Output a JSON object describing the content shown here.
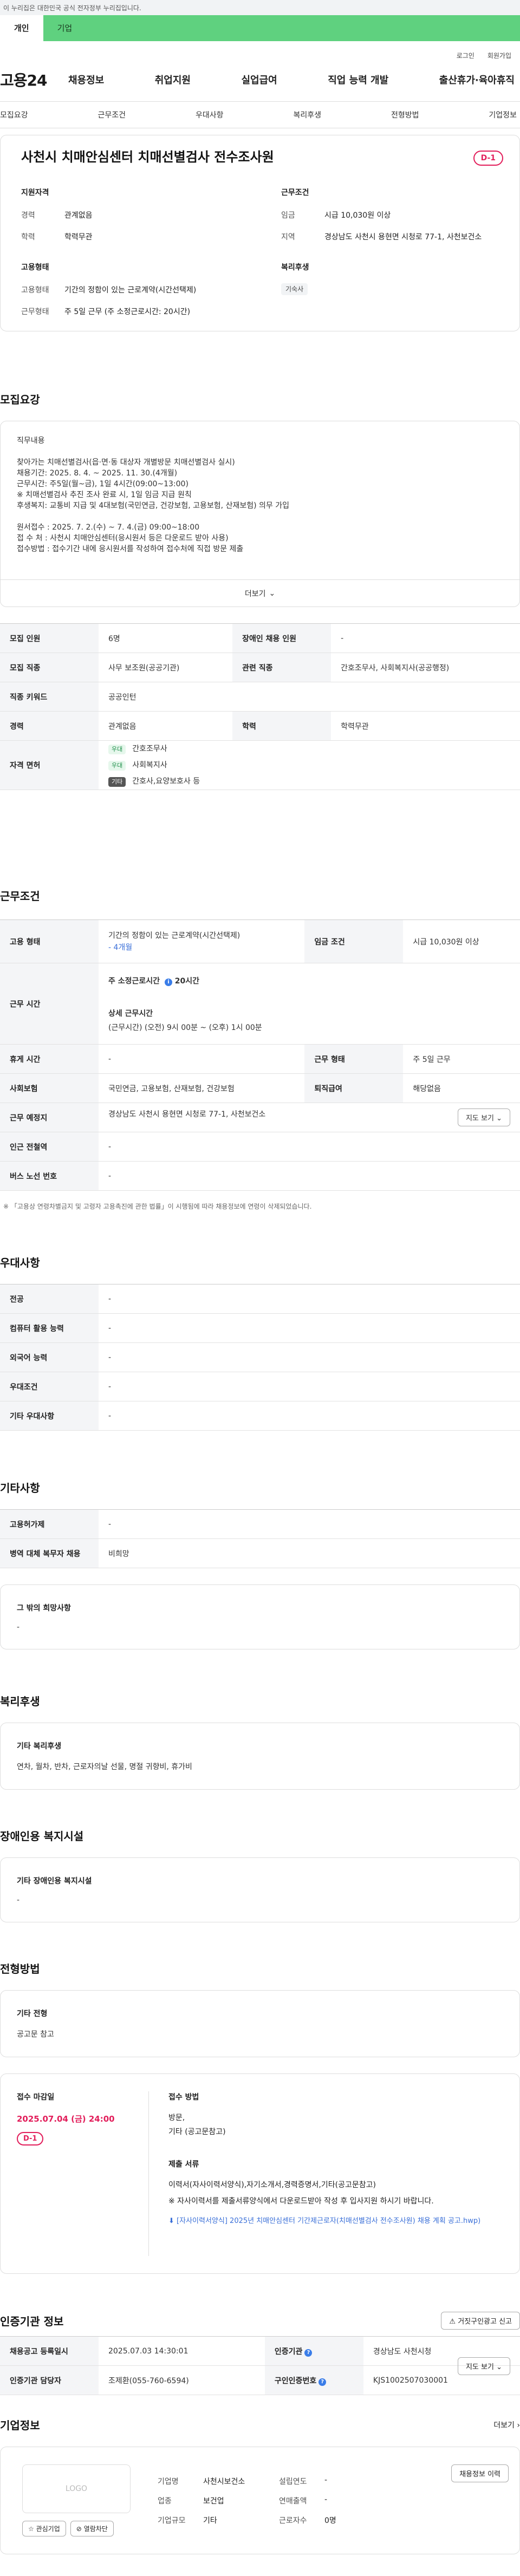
{
  "gov_notice": "이 누리집은 대한민국 공식 전자정부 누리집입니다.",
  "tabs": [
    "개인",
    "기업"
  ],
  "util_links": [
    "로그인",
    "회원가입"
  ],
  "brand": "고용24",
  "gnb": [
    "채용정보",
    "취업지원",
    "실업급여",
    "직업 능력 개발",
    "출산휴가·육아휴직"
  ],
  "subnav": [
    "모집요강",
    "근무조건",
    "우대사항",
    "복리후생",
    "전형방법",
    "기업정보"
  ],
  "job": {
    "title": "사천시 치매안심센터 치매선별검사 전수조사원",
    "dday": "D-1",
    "qual_title": "지원자격",
    "career_k": "경력",
    "career_v": "관계없음",
    "edu_k": "학력",
    "edu_v": "학력무관",
    "emp_title": "고용형태",
    "emp_k": "고용형태",
    "emp_v": "기간의 정함이 있는 근로계약(시간선택제)",
    "work_k": "근무형태",
    "work_v": "주 5일 근무 (주 소정근로시간: 20시간)",
    "cond_title": "근무조건",
    "wage_k": "임금",
    "wage_v": "시급 10,030원 이상",
    "loc_k": "지역",
    "loc_v": "경상남도 사천시 용현면 시청로 77-1, 사천보건소",
    "welfare_title": "복리후생",
    "welfare_tag": "기숙사"
  },
  "recruit": {
    "section": "모집요강",
    "detail_text": "직무내용\n\n찾아가는 치매선별검사(읍·면·동 대상자 개별방문 치매선별검사 실시)\n채용기간: 2025. 8. 4. ~ 2025. 11. 30.(4개월)\n근무시간: 주5일(월~금), 1일 4시간(09:00~13:00)\n     ※ 치매선별검사 추진 조사 완료 시, 1일 임금 지급 원칙\n 후생복지: 교통비 지급 및 4대보험(국민연금, 건강보험, 고용보험, 산재보험) 의무 가입\n\n원서접수 : 2025. 7. 2.(수) ~ 7. 4.(금) 09:00~18:00\n접 수 처 : 사천시 치매안심센터(응시원서 등은 다운로드 받아 사용)\n접수방법 : 접수기간 내에 응시원서를 작성하여 접수처에 직접 방문 제출",
    "more": "더보기",
    "rows": [
      [
        "모집 인원",
        "6명",
        "장애인 채용 인원",
        "-"
      ],
      [
        "모집 직종",
        "사무 보조원(공공기관)",
        "관련 직종",
        "간호조무사, 사회복지사(공공행정)"
      ],
      [
        "직종 키워드",
        "공공인턴",
        "",
        ""
      ],
      [
        "경력",
        "관계없음",
        "학력",
        "학력무관"
      ]
    ],
    "license_k": "자격 면허",
    "licenses": [
      {
        "badge": "우대",
        "name": "간호조무사"
      },
      {
        "badge": "우대",
        "name": "사회복지사"
      },
      {
        "badge": "기타",
        "name": "간호사,요양보호사 등"
      }
    ]
  },
  "conditions": {
    "section": "근무조건",
    "emp_k": "고용 형태",
    "emp_v": "기간의 정함이 있는 근로계약(시간선택제)",
    "emp_sub": "- 4개월",
    "wage_k": "임금 조건",
    "wage_v": "시급 10,030원 이상",
    "time_k": "근무 시간",
    "time_main": "주 소정근로시간",
    "time_main_v": "20시간",
    "time_detail_t": "상세 근무시간",
    "time_detail_v": "(근무시간) (오전) 9시 00분 ~ (오후) 1시 00분",
    "rows": [
      [
        "휴게 시간",
        "-",
        "근무 형태",
        "주 5일 근무"
      ],
      [
        "사회보험",
        "국민연금, 고용보험, 산재보험, 건강보험",
        "퇴직급여",
        "해당없음"
      ]
    ],
    "place_k": "근무 예정지",
    "place_v": "경상남도 사천시 용현면 시청로 77-1, 사천보건소",
    "map_btn": "지도 보기",
    "station_k": "인근 전철역",
    "station_v": "-",
    "bus_k": "버스 노선 번호",
    "bus_v": "-",
    "footnote": "※ 「고용상 연령차별금지 및 고령자 고용촉진에 관한 법률」이 시행됨에 따라 채용정보에 연령이 삭제되었습니다."
  },
  "preference": {
    "section": "우대사항",
    "rows": [
      [
        "전공",
        "-"
      ],
      [
        "컴퓨터 활용 능력",
        "-"
      ],
      [
        "외국어 능력",
        "-"
      ],
      [
        "우대조건",
        "-"
      ],
      [
        "기타 우대사항",
        "-"
      ]
    ]
  },
  "etc": {
    "section": "기타사항",
    "rows": [
      [
        "고용허가제",
        "-"
      ],
      [
        "병역 대체 복무자 채용",
        "비희망"
      ]
    ],
    "other_title": "그 밖의 희망사항",
    "other_v": "-"
  },
  "welfare": {
    "section": "복리후생",
    "title": "기타 복리후생",
    "value": "연차, 월차, 반차, 근로자의날 선물, 명절 귀향비, 휴가비"
  },
  "disability": {
    "section": "장애인용 복지시설",
    "title": "기타 장애인용 복지시설",
    "value": "-"
  },
  "selection": {
    "section": "전형방법",
    "title": "기타 전형",
    "value": "공고문 참고",
    "deadline_t": "접수 마감일",
    "deadline_v": "2025.07.04 (금) 24:00",
    "dday": "D-1",
    "method_t": "접수 방법",
    "method_v1": "방문,",
    "method_v2": "기타 (공고문참고)",
    "docs_t": "제출 서류",
    "docs_v": "이력서(자사이력서양식),자기소개서,경력증명서,기타(공고문참고)",
    "docs_note": "※ 자사이력서를 제출서류양식에서 다운로드받아 작성 후 입사지원 하시기 바랍니다.",
    "docs_link": "[자사이력서양식] 2025년 치매안심센터 기간제근로자(치매선별검사 전수조사원) 채용 계획 공고.hwp)"
  },
  "institution": {
    "section": "인증기관 정보",
    "report_btn": "거짓구인광고 신고",
    "rows": [
      [
        "채용공고 등록일시",
        "2025.07.03 14:30:01",
        "인증기관",
        "경상남도 사천시청"
      ],
      [
        "인증기관 담당자",
        "조제환(055-760-6594)",
        "구인인증번호",
        "KJS1002507030001"
      ]
    ],
    "map_btn": "지도 보기"
  },
  "company": {
    "section": "기업정보",
    "more": "더보기",
    "logo": "LOGO",
    "fav_btn": "관심기업",
    "block_btn": "열람차단",
    "info": [
      [
        "기업명",
        "사천시보건소",
        "설립연도",
        "-"
      ],
      [
        "업종",
        "보건업",
        "연매출액",
        "-"
      ],
      [
        "기업규모",
        "기타",
        "근로자수",
        "0명"
      ]
    ],
    "history_btn": "채용정보 이력"
  }
}
